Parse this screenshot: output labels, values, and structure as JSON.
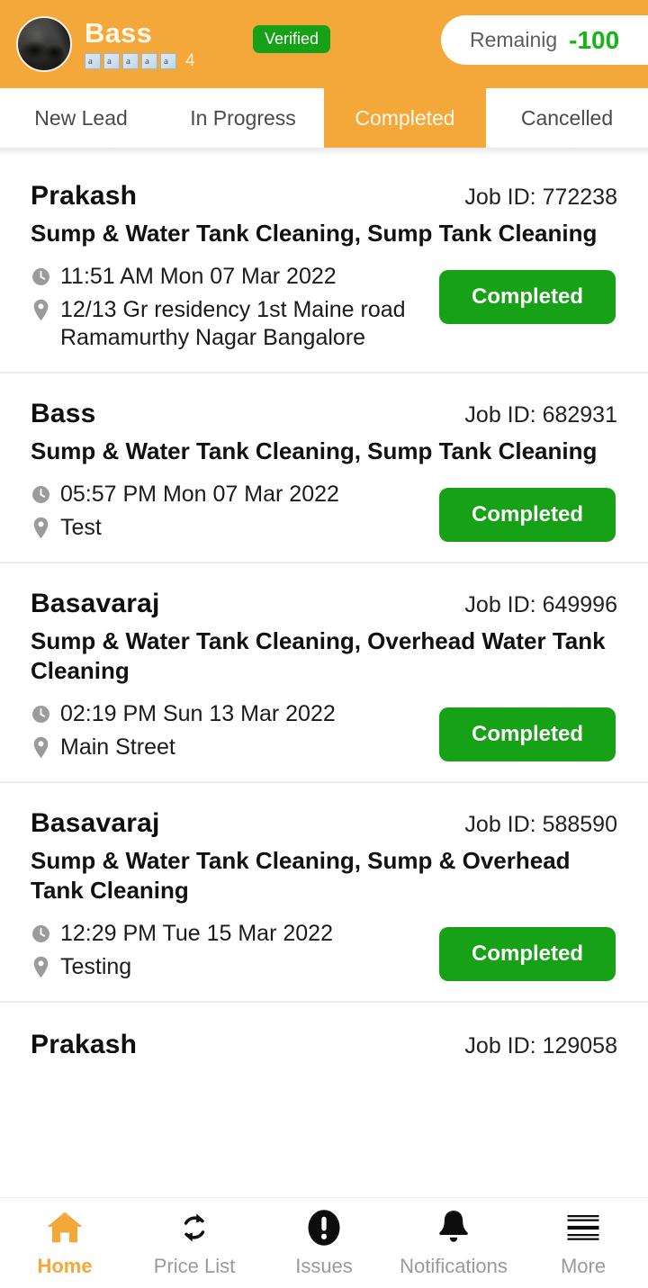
{
  "header": {
    "user_name": "Bass",
    "rating_count": "4",
    "rating_icons": [
      "broken-image-icon",
      "broken-image-icon",
      "broken-image-icon",
      "broken-image-icon",
      "broken-image-icon"
    ],
    "verified_badge": "Verified",
    "balance_label": "Remainig",
    "balance_value": "-100",
    "avatar_icon": "user-avatar-motorcycle",
    "colors": {
      "background": "#F5A83A",
      "verified_green": "#16A116",
      "balance_green": "#16B416"
    }
  },
  "tabs": [
    {
      "label": "New Lead",
      "active": false
    },
    {
      "label": "In Progress",
      "active": false
    },
    {
      "label": "Completed",
      "active": true
    },
    {
      "label": "Cancelled",
      "active": false
    }
  ],
  "jobs": [
    {
      "customer": "Prakash",
      "job_id_label": "Job ID: 772238",
      "service": "Sump & Water Tank Cleaning, Sump Tank Cleaning",
      "time": "11:51 AM Mon 07 Mar 2022",
      "address": "12/13 Gr residency 1st Maine road Ramamurthy Nagar Bangalore",
      "status": "Completed"
    },
    {
      "customer": "Bass",
      "job_id_label": "Job ID: 682931",
      "service": "Sump & Water Tank Cleaning, Sump Tank Cleaning",
      "time": "05:57 PM Mon 07 Mar 2022",
      "address": "Test",
      "status": "Completed"
    },
    {
      "customer": "Basavaraj",
      "job_id_label": "Job ID: 649996",
      "service": "Sump & Water Tank Cleaning, Overhead Water Tank Cleaning",
      "time": "02:19 PM Sun 13 Mar 2022",
      "address": "Main Street",
      "status": "Completed"
    },
    {
      "customer": "Basavaraj",
      "job_id_label": "Job ID: 588590",
      "service": "Sump & Water Tank Cleaning, Sump & Overhead Tank Cleaning",
      "time": "12:29 PM Tue 15 Mar 2022",
      "address": "Testing",
      "status": "Completed"
    }
  ],
  "partial_job": {
    "customer": "Prakash",
    "job_id_label": "Job ID: 129058"
  },
  "bottom_nav": [
    {
      "label": "Home",
      "icon": "home-icon",
      "active": true
    },
    {
      "label": "Price List",
      "icon": "refresh-icon",
      "active": false
    },
    {
      "label": "Issues",
      "icon": "exclamation-circle-icon",
      "active": false
    },
    {
      "label": "Notifications",
      "icon": "bell-icon",
      "active": false
    },
    {
      "label": "More",
      "icon": "hamburger-menu-icon",
      "active": false
    }
  ],
  "icons": {
    "time": "clock-icon",
    "address": "location-pin-icon"
  }
}
